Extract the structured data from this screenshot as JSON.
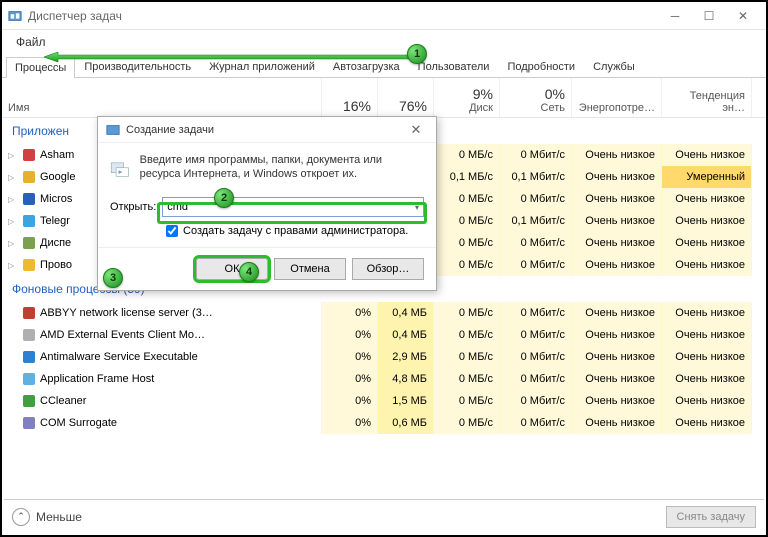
{
  "window": {
    "title": "Диспетчер задач",
    "menu_file": "Файл"
  },
  "tabs": [
    "Процессы",
    "Производительность",
    "Журнал приложений",
    "Автозагрузка",
    "Пользователи",
    "Подробности",
    "Службы"
  ],
  "columns": {
    "name": "Имя",
    "cpu_pct": "16%",
    "mem_pct": "76%",
    "disk_pct": "9%",
    "disk_lbl": "Диск",
    "net_pct": "0%",
    "net_lbl": "Сеть",
    "power_lbl": "Энергопотре…",
    "trend_lbl": "Тенденция эн…"
  },
  "sections": {
    "apps": "Приложен",
    "bg": "Фоновые процессы (59)"
  },
  "apps": [
    {
      "name": "Asham",
      "cpu": "",
      "mem": "",
      "disk": "0 МБ/с",
      "net": "0 Мбит/с",
      "power": "Очень низкое",
      "trend": "Очень низкое"
    },
    {
      "name": "Google",
      "cpu": "",
      "mem": "",
      "disk": "0,1 МБ/с",
      "net": "0,1 Мбит/с",
      "power": "Очень низкое",
      "trend": "Умеренный",
      "hl": true
    },
    {
      "name": "Micros",
      "cpu": "",
      "mem": "",
      "disk": "0 МБ/с",
      "net": "0 Мбит/с",
      "power": "Очень низкое",
      "trend": "Очень низкое"
    },
    {
      "name": "Telegr",
      "cpu": "",
      "mem": "",
      "disk": "0 МБ/с",
      "net": "0,1 Мбит/с",
      "power": "Очень низкое",
      "trend": "Очень низкое"
    },
    {
      "name": "Диспе",
      "cpu": "",
      "mem": "",
      "disk": "0 МБ/с",
      "net": "0 Мбит/с",
      "power": "Очень низкое",
      "trend": "Очень низкое"
    },
    {
      "name": "Прово",
      "cpu": "",
      "mem": "",
      "disk": "0 МБ/с",
      "net": "0 Мбит/с",
      "power": "Очень низкое",
      "trend": "Очень низкое"
    }
  ],
  "bg": [
    {
      "name": "ABBYY network license server (3…",
      "cpu": "0%",
      "mem": "0,4 МБ",
      "disk": "0 МБ/с",
      "net": "0 Мбит/с",
      "power": "Очень низкое",
      "trend": "Очень низкое"
    },
    {
      "name": "AMD External Events Client Mo…",
      "cpu": "0%",
      "mem": "0,4 МБ",
      "disk": "0 МБ/с",
      "net": "0 Мбит/с",
      "power": "Очень низкое",
      "trend": "Очень низкое"
    },
    {
      "name": "Antimalware Service Executable",
      "cpu": "0%",
      "mem": "2,9 МБ",
      "disk": "0 МБ/с",
      "net": "0 Мбит/с",
      "power": "Очень низкое",
      "trend": "Очень низкое"
    },
    {
      "name": "Application Frame Host",
      "cpu": "0%",
      "mem": "4,8 МБ",
      "disk": "0 МБ/с",
      "net": "0 Мбит/с",
      "power": "Очень низкое",
      "trend": "Очень низкое"
    },
    {
      "name": "CCleaner",
      "cpu": "0%",
      "mem": "1,5 МБ",
      "disk": "0 МБ/с",
      "net": "0 Мбит/с",
      "power": "Очень низкое",
      "trend": "Очень низкое"
    },
    {
      "name": "COM Surrogate",
      "cpu": "0%",
      "mem": "0,6 МБ",
      "disk": "0 МБ/с",
      "net": "0 Мбит/с",
      "power": "Очень низкое",
      "trend": "Очень низкое"
    }
  ],
  "footer": {
    "fewer": "Меньше",
    "endtask": "Снять задачу"
  },
  "dialog": {
    "title": "Создание задачи",
    "message": "Введите имя программы, папки, документа или ресурса Интернета, и Windows откроет их.",
    "open_label": "Открыть:",
    "open_value": "cmd",
    "admin_label": "Создать задачу с правами администратора.",
    "ok": "ОК",
    "cancel": "Отмена",
    "browse": "Обзор…"
  },
  "annotations": {
    "b1": "1",
    "b2": "2",
    "b3": "3",
    "b4": "4"
  }
}
